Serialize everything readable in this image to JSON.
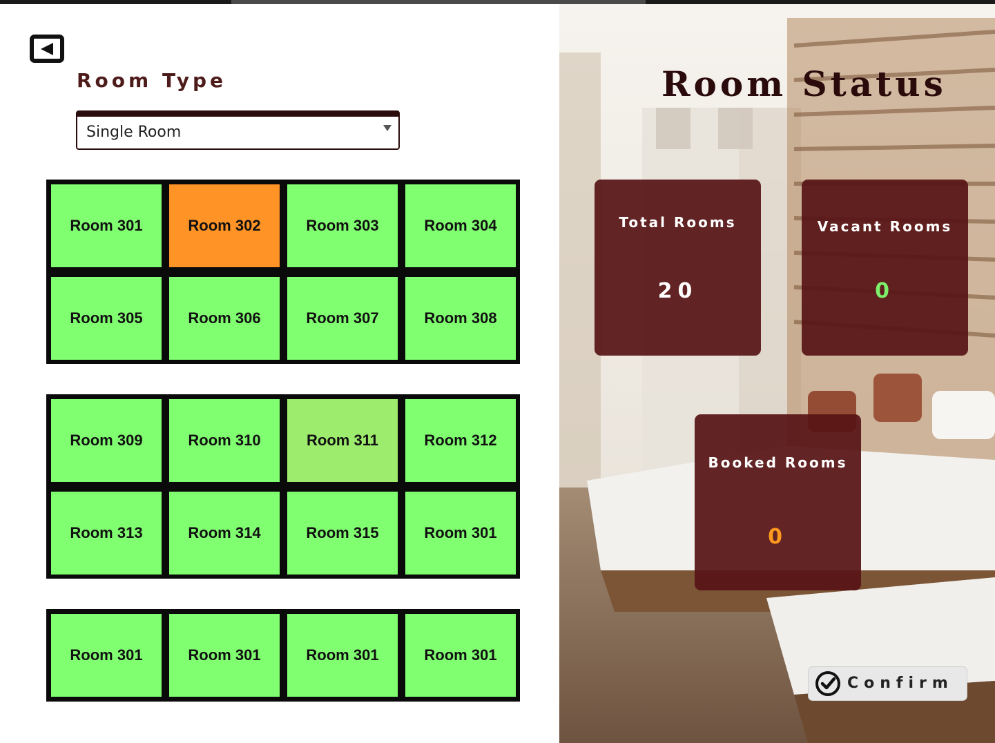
{
  "left_panel": {
    "room_type_label": "Room Type",
    "room_type_select": {
      "value": "Single Room"
    },
    "room_grids": [
      {
        "rooms": [
          {
            "label": "Room 301",
            "status": "vacant"
          },
          {
            "label": "Room 302",
            "status": "booked"
          },
          {
            "label": "Room 303",
            "status": "vacant"
          },
          {
            "label": "Room 304",
            "status": "vacant"
          },
          {
            "label": "Room 305",
            "status": "vacant"
          },
          {
            "label": "Room 306",
            "status": "vacant"
          },
          {
            "label": "Room 307",
            "status": "vacant"
          },
          {
            "label": "Room 308",
            "status": "vacant"
          }
        ]
      },
      {
        "rooms": [
          {
            "label": "Room 309",
            "status": "vacant"
          },
          {
            "label": "Room 310",
            "status": "vacant"
          },
          {
            "label": "Room 311",
            "status": "hover"
          },
          {
            "label": "Room 312",
            "status": "vacant"
          },
          {
            "label": "Room 313",
            "status": "vacant"
          },
          {
            "label": "Room 314",
            "status": "vacant"
          },
          {
            "label": "Room 315",
            "status": "vacant"
          },
          {
            "label": "Room 301",
            "status": "vacant"
          }
        ]
      },
      {
        "rooms": [
          {
            "label": "Room 301",
            "status": "vacant"
          },
          {
            "label": "Room 301",
            "status": "vacant"
          },
          {
            "label": "Room 301",
            "status": "vacant"
          },
          {
            "label": "Room 301",
            "status": "vacant"
          }
        ]
      }
    ],
    "colors": {
      "vacant": "#80ff70",
      "booked": "#ff9326",
      "hover": "#9dec6d"
    }
  },
  "right_panel": {
    "title": "Room Status",
    "cards": {
      "total": {
        "label": "Total Rooms",
        "value": "20"
      },
      "vacant": {
        "label": "Vacant Rooms",
        "value": "0"
      },
      "booked": {
        "label": "Booked Rooms",
        "value": "0"
      }
    },
    "value_colors": {
      "total": "#ffffff",
      "vacant": "#7cf06b",
      "booked": "#ff9a1f"
    },
    "confirm_label": "Confirm"
  },
  "icons": {
    "back": "back-arrow-icon",
    "confirm": "check-circle-icon",
    "dropdown": "chevron-down-icon"
  }
}
